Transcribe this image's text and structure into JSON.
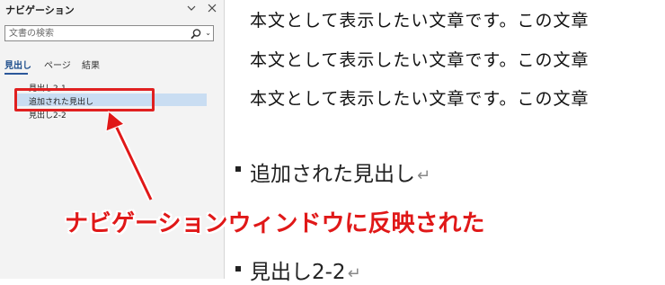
{
  "nav": {
    "title": "ナビゲーション",
    "search_placeholder": "文書の検索",
    "tabs": [
      "見出し",
      "ページ",
      "結果"
    ],
    "headings": [
      "見出し2-1",
      "追加された見出し",
      "見出し2-2"
    ]
  },
  "document": {
    "body_text": "本文として表示したい文章です。この文章",
    "headings": [
      "追加された見出し",
      "見出し2-2"
    ],
    "para_mark": "↵"
  },
  "annotation": {
    "text": "ナビゲーションウィンドウに反映された",
    "color": "#e01818"
  },
  "colors": {
    "selection": "#c9ddf2",
    "accent": "#2b579a",
    "pane_bg": "#f3f3f3"
  }
}
